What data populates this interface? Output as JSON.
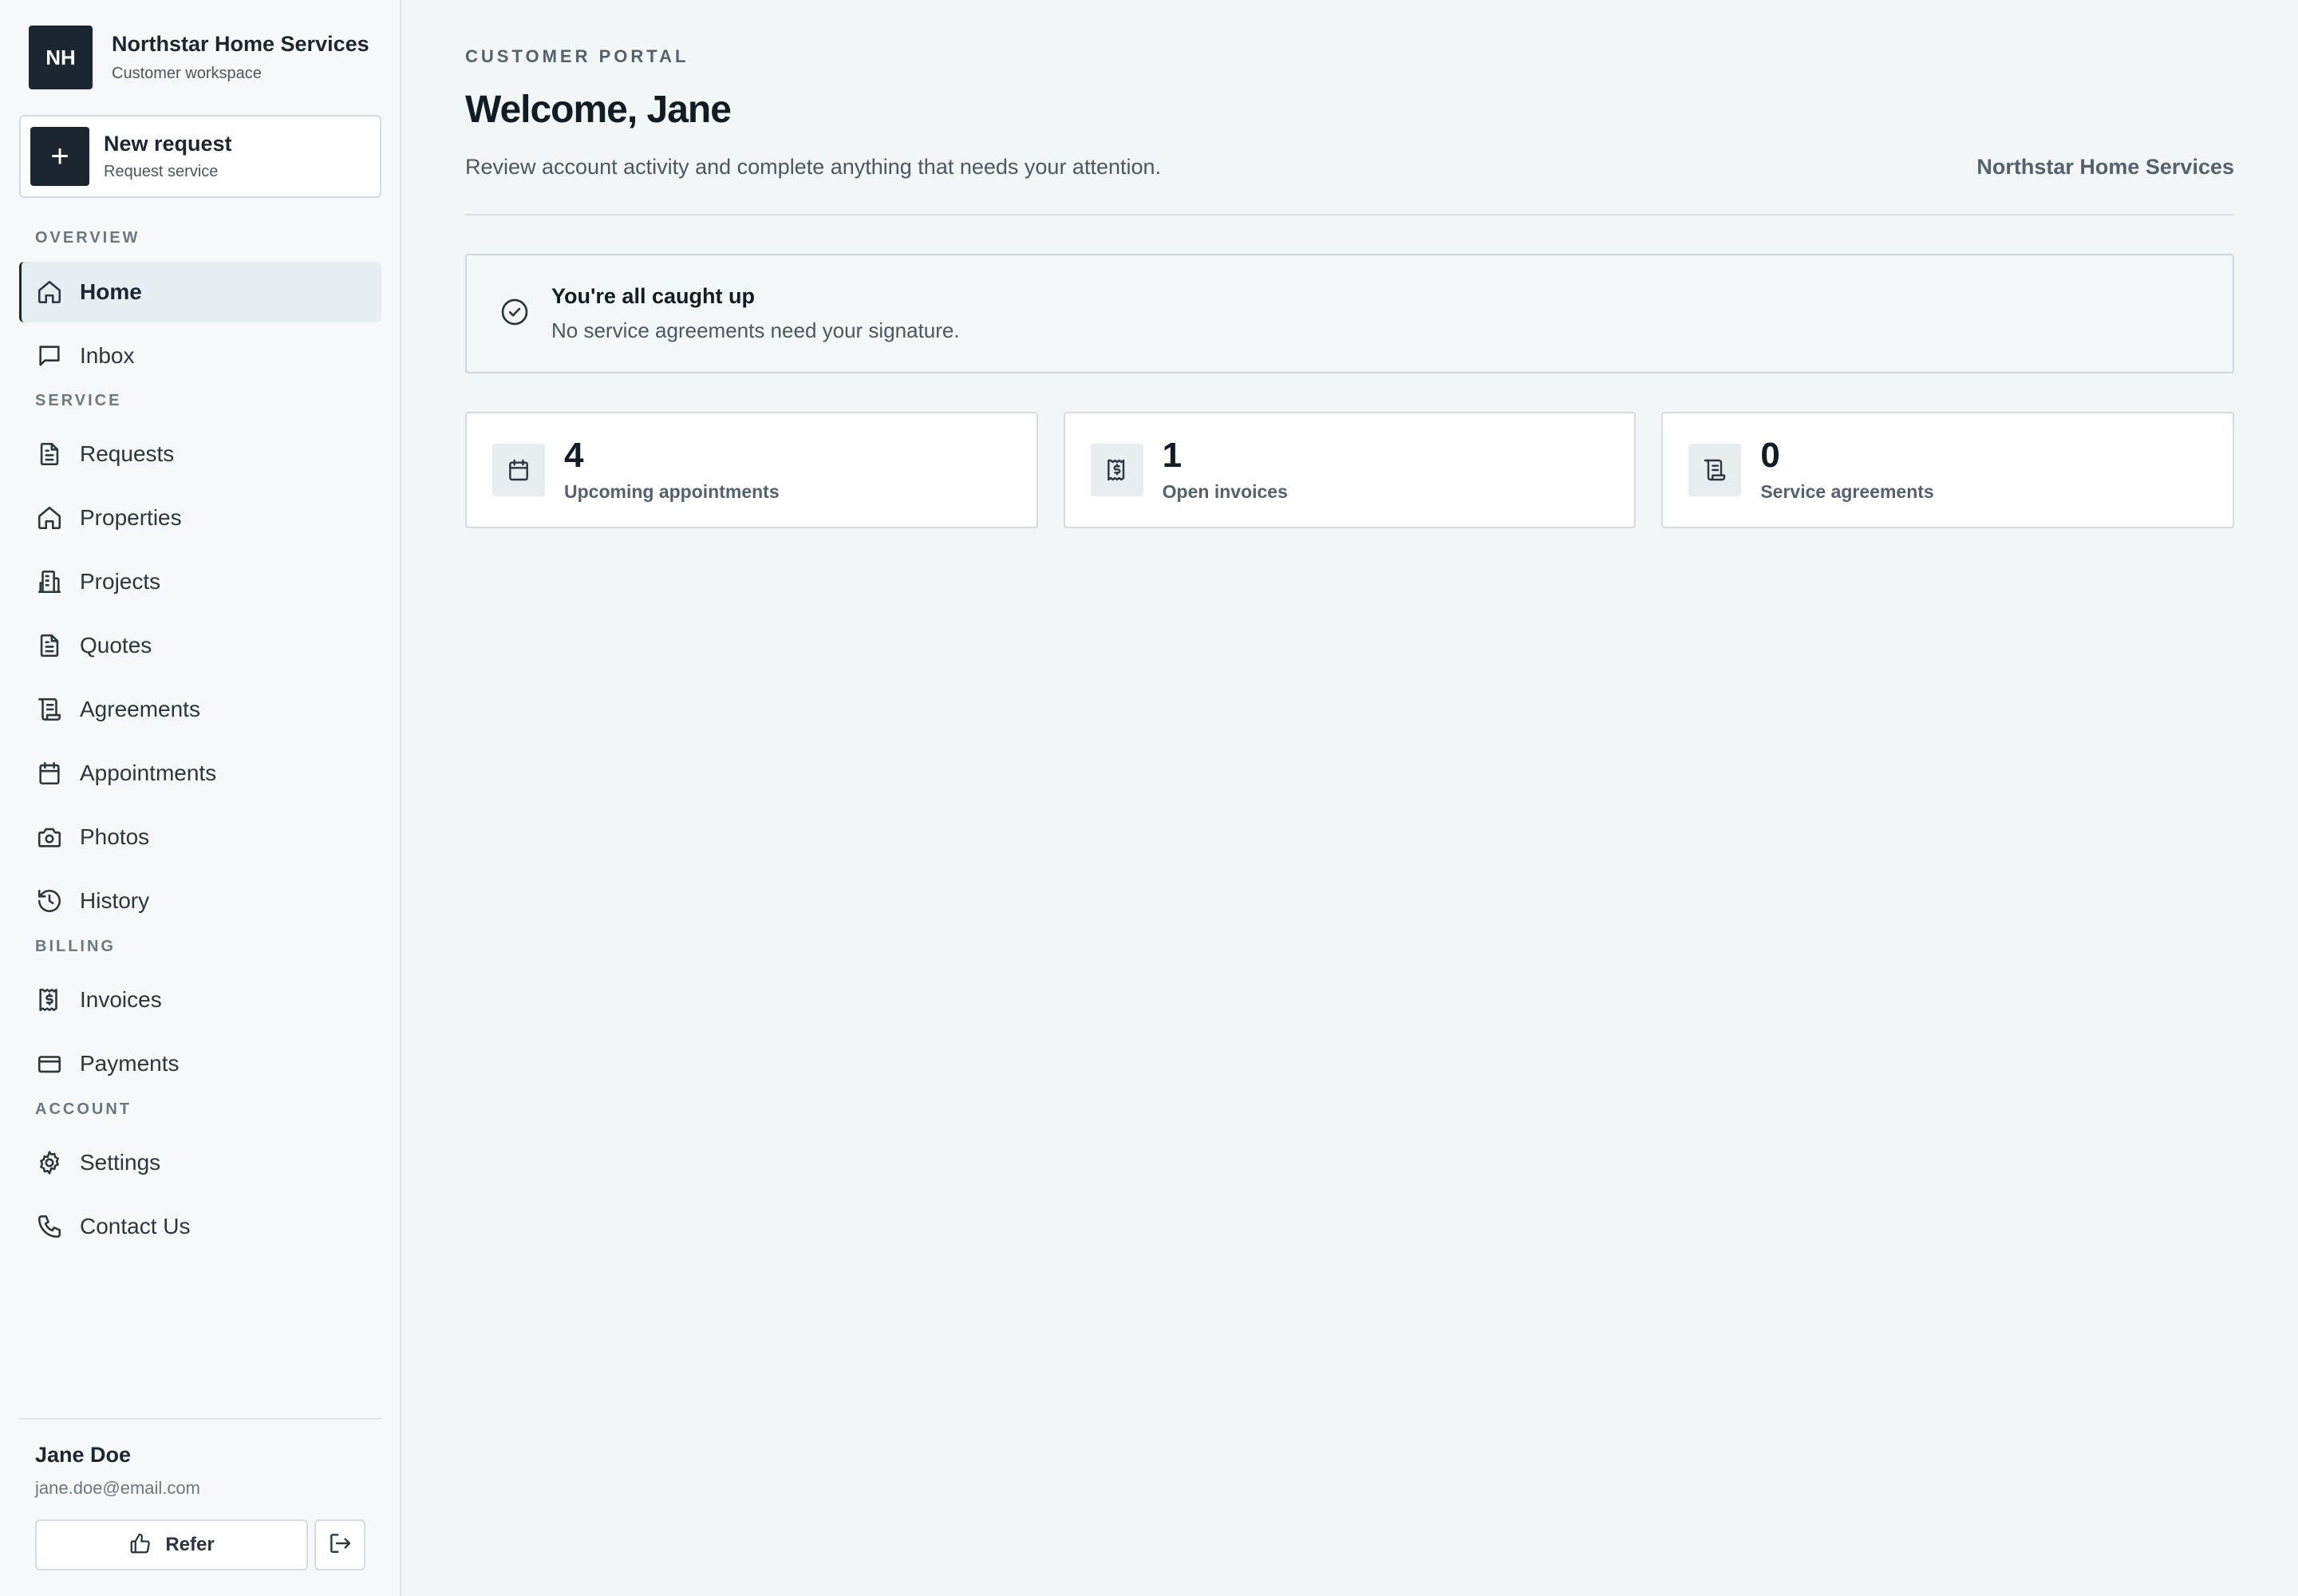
{
  "brand": {
    "initials": "NH",
    "name": "Northstar Home Services",
    "subtitle": "Customer workspace"
  },
  "new_request": {
    "title": "New request",
    "subtitle": "Request service",
    "icon": "plus-icon"
  },
  "sidebar": {
    "sections": {
      "overview": "OVERVIEW",
      "service": "SERVICE",
      "billing": "BILLING",
      "account": "ACCOUNT"
    },
    "items": [
      {
        "label": "Home",
        "icon": "home-icon",
        "active": true
      },
      {
        "label": "Inbox",
        "icon": "message-icon"
      },
      {
        "label": "Requests",
        "icon": "document-icon"
      },
      {
        "label": "Properties",
        "icon": "home-icon"
      },
      {
        "label": "Projects",
        "icon": "building-icon"
      },
      {
        "label": "Quotes",
        "icon": "document-icon"
      },
      {
        "label": "Agreements",
        "icon": "scroll-icon"
      },
      {
        "label": "Appointments",
        "icon": "calendar-icon"
      },
      {
        "label": "Photos",
        "icon": "camera-icon"
      },
      {
        "label": "History",
        "icon": "history-icon"
      },
      {
        "label": "Invoices",
        "icon": "receipt-icon"
      },
      {
        "label": "Payments",
        "icon": "credit-card-icon"
      },
      {
        "label": "Settings",
        "icon": "gear-icon"
      },
      {
        "label": "Contact Us",
        "icon": "phone-icon"
      }
    ]
  },
  "user": {
    "name": "Jane Doe",
    "email": "jane.doe@email.com",
    "refer_label": "Refer"
  },
  "main": {
    "eyebrow": "CUSTOMER PORTAL",
    "title": "Welcome, Jane",
    "description": "Review account activity and complete anything that needs your attention.",
    "company": "Northstar Home Services",
    "notice": {
      "title": "You're all caught up",
      "body": "No service agreements need your signature."
    },
    "stats": [
      {
        "value": "4",
        "label": "Upcoming appointments",
        "icon": "calendar-icon"
      },
      {
        "value": "1",
        "label": "Open invoices",
        "icon": "receipt-icon"
      },
      {
        "value": "0",
        "label": "Service agreements",
        "icon": "scroll-icon"
      }
    ]
  },
  "colors": {
    "primary": "#1b2630",
    "background": "#f3f6f7",
    "sidebar_bg": "#f6f8f9",
    "active_bg": "#e7eef1",
    "border": "#d5dbe0",
    "muted_text": "#55626d"
  }
}
